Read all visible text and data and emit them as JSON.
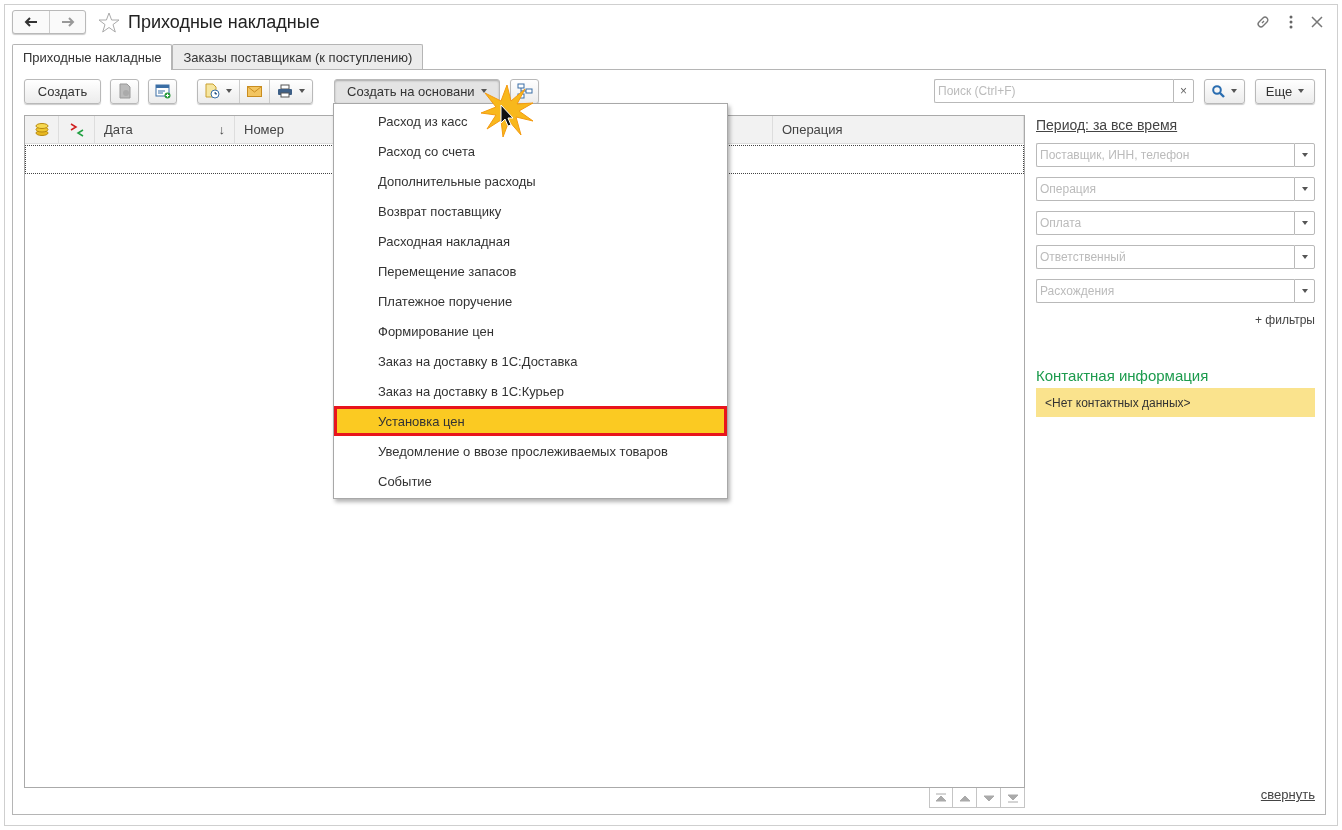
{
  "window": {
    "title": "Приходные накладные"
  },
  "tabs": [
    {
      "label": "Приходные накладные",
      "selected": true
    },
    {
      "label": "Заказы поставщикам (к поступлению)",
      "selected": false
    }
  ],
  "toolbar": {
    "create_button": "Создать",
    "create_based_on_button": "Создать на основани",
    "search": {
      "placeholder": "Поиск (Ctrl+F)",
      "clear": "×"
    },
    "more_button": "Еще"
  },
  "table": {
    "columns": [
      {
        "kind": "coins"
      },
      {
        "kind": "compare"
      },
      {
        "kind": "text",
        "label": "Дата",
        "sort": "↓"
      },
      {
        "kind": "text",
        "label": "Номер"
      },
      {
        "kind": "blank"
      },
      {
        "kind": "text",
        "label": "Операция"
      }
    ]
  },
  "menu": {
    "items": [
      {
        "label": "Расход из касс",
        "selected": false
      },
      {
        "label": "Расход со счета",
        "selected": false
      },
      {
        "label": "Дополнительные расходы",
        "selected": false
      },
      {
        "label": "Возврат поставщику",
        "selected": false
      },
      {
        "label": "Расходная накладная",
        "selected": false
      },
      {
        "label": "Перемещение запасов",
        "selected": false
      },
      {
        "label": "Платежное поручение",
        "selected": false
      },
      {
        "label": "Формирование цен",
        "selected": false
      },
      {
        "label": "Заказ на доставку в 1С:Доставка",
        "selected": false
      },
      {
        "label": "Заказ на доставку в 1С:Курьер",
        "selected": false
      },
      {
        "label": "Установка цен",
        "selected": true
      },
      {
        "label": "Уведомление о ввозе прослеживаемых товаров",
        "selected": false
      },
      {
        "label": "Событие",
        "selected": false
      }
    ]
  },
  "filters": {
    "period_link": "Период: за все время",
    "fields": [
      {
        "placeholder": "Поставщик, ИНН, телефон"
      },
      {
        "placeholder": "Операция"
      },
      {
        "placeholder": "Оплата"
      },
      {
        "placeholder": "Ответственный"
      },
      {
        "placeholder": "Расхождения"
      }
    ],
    "more_filters_link": "+ фильтры"
  },
  "contact": {
    "title": "Контактная информация",
    "empty_text": "<Нет контактных данных>"
  },
  "collapse_link": "свернуть"
}
